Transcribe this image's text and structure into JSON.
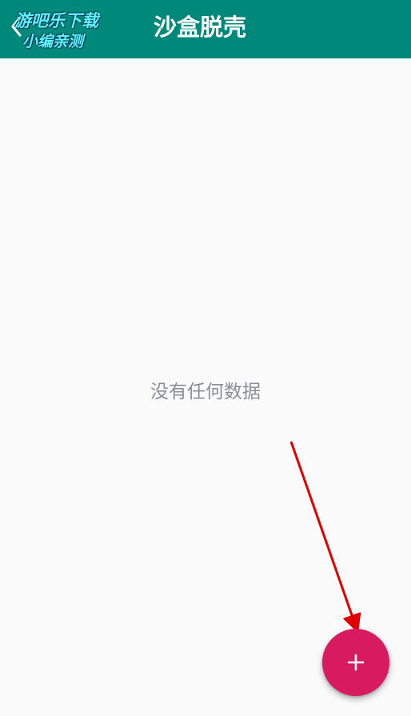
{
  "appbar": {
    "title": "沙盒脱壳",
    "back_icon": "chevron-left-icon",
    "color": "#00897b"
  },
  "watermark": {
    "line1": "游吧乐下载",
    "line2": "小编亲测"
  },
  "content": {
    "empty_message": "没有任何数据"
  },
  "fab": {
    "icon": "plus-icon",
    "color": "#d81b60"
  },
  "annotation": {
    "color": "#e00000"
  }
}
